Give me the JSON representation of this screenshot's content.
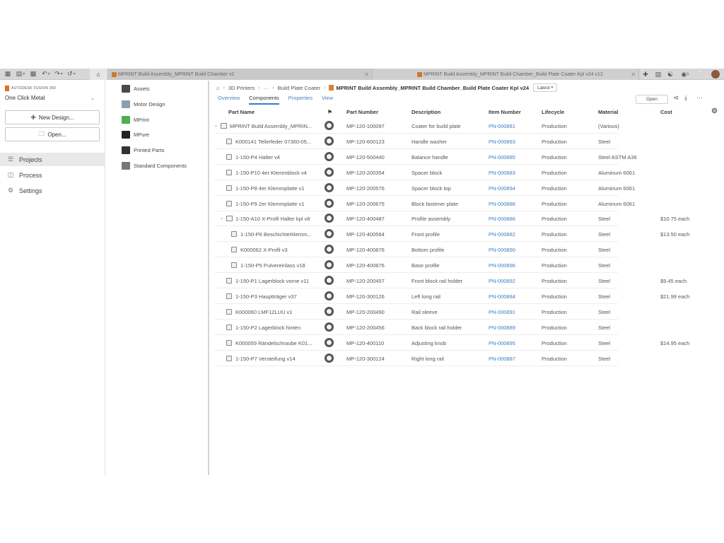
{
  "toolbar": {
    "tabs": [
      {
        "label": "MPRINT Build Assembly_MPRINT Build Chamber v2"
      },
      {
        "label": "MPRINT Build Assembly_MPRINT Build Chamber_Build Plate Coater Kpl v24 v12"
      }
    ],
    "notif_count": "1"
  },
  "left_panel": {
    "brand": "AUTODESK FUSION 360",
    "team": "One Click Metal",
    "new_design": "New Design...",
    "open": "Open...",
    "nav": [
      {
        "label": "Projects",
        "icon": "projects-icon"
      },
      {
        "label": "Process",
        "icon": "process-icon"
      },
      {
        "label": "Settings",
        "icon": "settings-icon"
      }
    ]
  },
  "projects": [
    {
      "label": "Assets",
      "color": "#4a4a4a"
    },
    {
      "label": "Motor Design",
      "color": "#8aa0b0"
    },
    {
      "label": "MPrint",
      "color": "#4caf50"
    },
    {
      "label": "MPure",
      "color": "#222222"
    },
    {
      "label": "Printed Parts",
      "color": "#333333"
    },
    {
      "label": "Standard Components",
      "color": "#777777"
    }
  ],
  "breadcrumb": {
    "items": [
      "3D Printers",
      "···",
      "Build Plate Coater"
    ],
    "current": "MPRINT Build Assembly_MPRINT Build Chamber_Build Plate Coater Kpl v24",
    "version": "Latest"
  },
  "subtabs": [
    "Overview",
    "Components",
    "Properties",
    "View"
  ],
  "open_label": "Open",
  "table": {
    "headers": {
      "part_name": "Part Name",
      "part_number": "Part Number",
      "description": "Description",
      "item_number": "Item Number",
      "lifecycle": "Lifecycle",
      "material": "Material",
      "cost": "Cost"
    },
    "rows": [
      {
        "level": 0,
        "type": "assembly",
        "expanded": true,
        "name": "MPRINT Build Assembly_MPRIN...",
        "part_number": "MP-120-100097",
        "description": "Coater for build plate",
        "item_number": "PN-000881",
        "lifecycle": "Production",
        "material": "(Various)",
        "cost": ""
      },
      {
        "level": 1,
        "type": "part",
        "name": "K000141 Tellerfeder 07360-05...",
        "part_number": "MP-120-600123",
        "description": "Handle washer",
        "item_number": "PN-000893",
        "lifecycle": "Production",
        "material": "Steel",
        "cost": ""
      },
      {
        "level": 1,
        "type": "part",
        "name": "1-150-P4 Halter v4",
        "part_number": "MP-120-500440",
        "description": "Balance handle",
        "item_number": "PN-000885",
        "lifecycle": "Production",
        "material": "Steel ASTM A36",
        "cost": ""
      },
      {
        "level": 1,
        "type": "part",
        "name": "1-150-P10 4er Klemmblock v4",
        "part_number": "MP-120-200354",
        "description": "Spacer block",
        "item_number": "PN-000883",
        "lifecycle": "Production",
        "material": "Aluminum 6061",
        "cost": ""
      },
      {
        "level": 1,
        "type": "part",
        "name": "1-150-P8 4er Klemmplatte v1",
        "part_number": "MP-120-200576",
        "description": "Spacer block top",
        "item_number": "PN-000894",
        "lifecycle": "Production",
        "material": "Aluminum 6061",
        "cost": ""
      },
      {
        "level": 1,
        "type": "part",
        "name": "1-150-P9 2er Klemmplatte v1",
        "part_number": "MP-120-200675",
        "description": "Block fastener plate",
        "item_number": "PN-000888",
        "lifecycle": "Production",
        "material": "Aluminum 6061",
        "cost": ""
      },
      {
        "level": 1,
        "type": "assembly",
        "expanded": true,
        "name": "1-150-A10 X-Profil Halter kpl v8",
        "part_number": "MP-120-400487",
        "description": "Profile assembly",
        "item_number": "PN-000886",
        "lifecycle": "Production",
        "material": "Steel",
        "cost": "$10.75 each"
      },
      {
        "level": 2,
        "type": "part",
        "name": "1-150-P6 Beschichterklemm...",
        "part_number": "MP-120-400564",
        "description": "Front profile",
        "item_number": "PN-000882",
        "lifecycle": "Production",
        "material": "Steel",
        "cost": "$13.50 each"
      },
      {
        "level": 2,
        "type": "part",
        "name": "K000062 X-Profil v3",
        "part_number": "MP-120-400876",
        "description": "Bottom profile",
        "item_number": "PN-000890",
        "lifecycle": "Production",
        "material": "Steel",
        "cost": ""
      },
      {
        "level": 2,
        "type": "part",
        "name": "1-150-P5 Pulvereinlass v18",
        "part_number": "MP-120-400876",
        "description": "Base profile",
        "item_number": "PN-000896",
        "lifecycle": "Production",
        "material": "Steel",
        "cost": ""
      },
      {
        "level": 1,
        "type": "part",
        "name": "1-150-P1 Lagerblock vorne v11",
        "part_number": "MP-120-200457",
        "description": "Front block rail holder",
        "item_number": "PN-000892",
        "lifecycle": "Production",
        "material": "Steel",
        "cost": "$9.45 each"
      },
      {
        "level": 1,
        "type": "part",
        "name": "1-150-P3 Hauptträger v37",
        "part_number": "MP-120-300126",
        "description": "Left long rail",
        "item_number": "PN-000884",
        "lifecycle": "Production",
        "material": "Steel",
        "cost": "$21.99 each"
      },
      {
        "level": 1,
        "type": "part",
        "name": "K000060 LMF12LUU v1",
        "part_number": "MP-120-200490",
        "description": "Rail sleeve",
        "item_number": "PN-000891",
        "lifecycle": "Production",
        "material": "Steel",
        "cost": ""
      },
      {
        "level": 1,
        "type": "part",
        "name": "1-150-P2 Lagerblock hinten",
        "part_number": "MP-120-200456",
        "description": "Back block rail holder",
        "item_number": "PN-000889",
        "lifecycle": "Production",
        "material": "Steel",
        "cost": ""
      },
      {
        "level": 1,
        "type": "part",
        "name": "K000059 Rändelschraube K01...",
        "part_number": "MP-120-400110",
        "description": "Adjusting knob",
        "item_number": "PN-000895",
        "lifecycle": "Production",
        "material": "Steel",
        "cost": "$14.95 each"
      },
      {
        "level": 1,
        "type": "part",
        "name": "1-150-P7 Versteifung v14",
        "part_number": "MP-120-300124",
        "description": "Right long rail",
        "item_number": "PN-000887",
        "lifecycle": "Production",
        "material": "Steel",
        "cost": ""
      }
    ]
  }
}
